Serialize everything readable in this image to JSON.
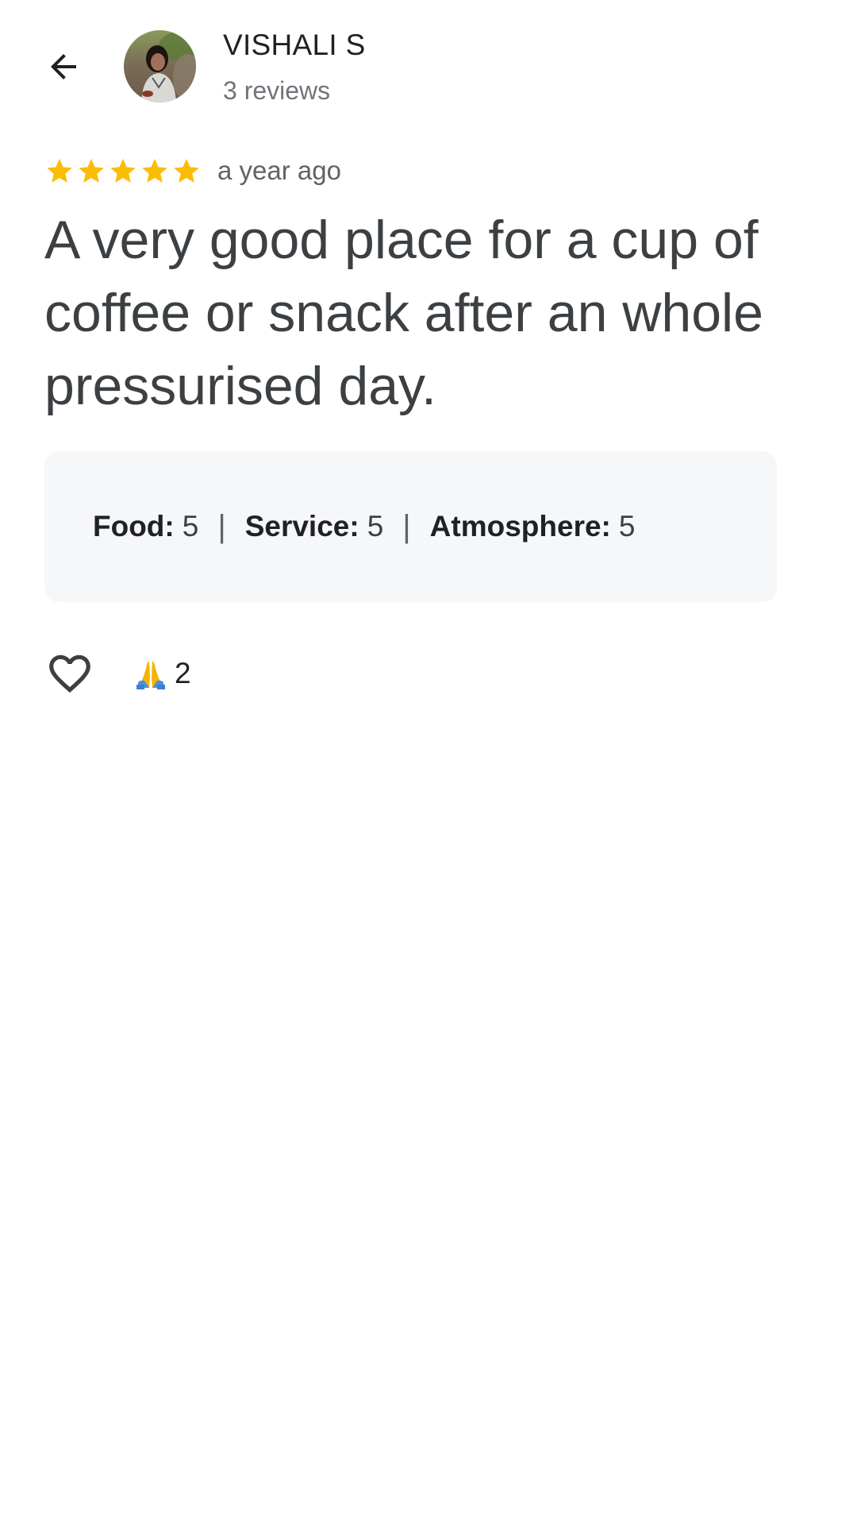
{
  "header": {
    "back_icon": "arrow-left-icon",
    "reviewer_name": "VISHALI S",
    "review_count": "3 reviews"
  },
  "review": {
    "rating": 5,
    "rating_max": 5,
    "star_color": "#fbbc04",
    "time_ago": "a year ago",
    "text": "A very good place for a cup of coffee or snack after an whole pressurised day.",
    "attributes": [
      {
        "label": "Food:",
        "value": "5"
      },
      {
        "label": "Service:",
        "value": "5"
      },
      {
        "label": "Atmosphere:",
        "value": "5"
      }
    ],
    "attributes_separator": "|"
  },
  "actions": {
    "like_icon": "heart-outline-icon",
    "reaction_icon": "folded-hands-emoji-icon",
    "reaction_count": "2"
  }
}
